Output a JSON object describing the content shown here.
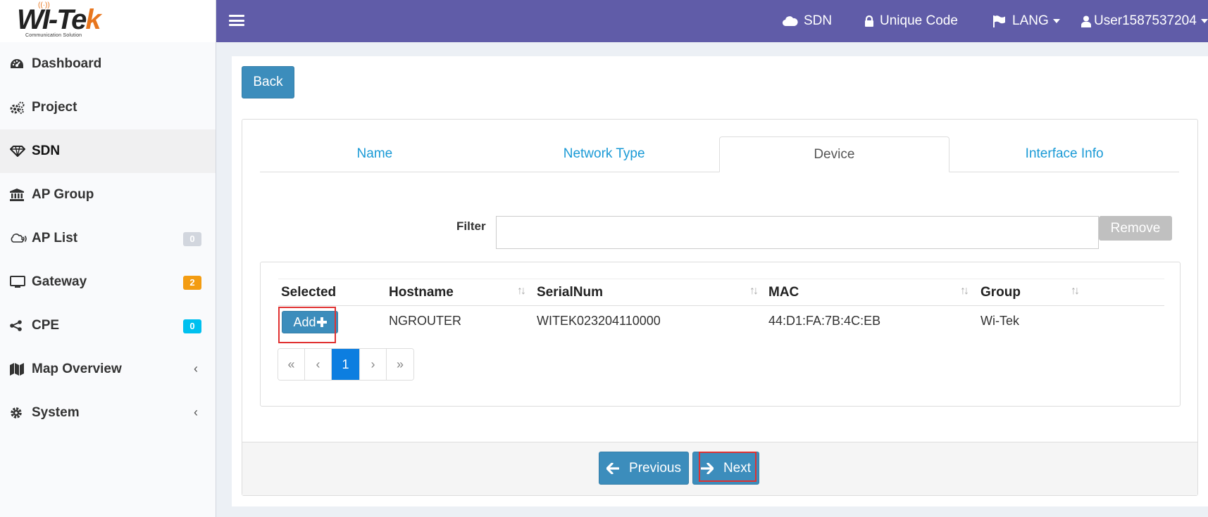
{
  "brand": {
    "logo_main": "WI-Te",
    "logo_k": "k",
    "logo_sub": "Communication Solution",
    "accent": "#e8761e"
  },
  "header": {
    "bg_color": "#605ca8",
    "sdn": "SDN",
    "unique_code": "Unique Code",
    "lang": "LANG",
    "user": "User1587537204"
  },
  "sidebar": {
    "items": [
      {
        "label": "Dashboard",
        "icon": "dashboard-icon"
      },
      {
        "label": "Project",
        "icon": "cogs-icon"
      },
      {
        "label": "SDN",
        "icon": "diamond-icon",
        "active": true
      },
      {
        "label": "AP Group",
        "icon": "bank-icon"
      },
      {
        "label": "AP List",
        "icon": "cloud-wifi-icon",
        "badge": "0",
        "badge_color": "#d2d6de"
      },
      {
        "label": "Gateway",
        "icon": "monitor-icon",
        "badge": "2",
        "badge_color": "#f39c12"
      },
      {
        "label": "CPE",
        "icon": "share-icon",
        "badge": "0",
        "badge_color": "#00c0ef"
      },
      {
        "label": "Map Overview",
        "icon": "map-icon",
        "chevron": "‹"
      },
      {
        "label": "System",
        "icon": "gear-icon",
        "chevron": "‹"
      }
    ]
  },
  "main": {
    "back_label": "Back",
    "tabs": [
      "Name",
      "Network Type",
      "Device",
      "Interface Info"
    ],
    "active_tab": "Device",
    "filter_label": "Filter",
    "filter_value": "",
    "remove_label": "Remove",
    "table": {
      "headers": [
        "Selected",
        "Hostname",
        "SerialNum",
        "MAC",
        "Group"
      ],
      "rows": [
        {
          "action": "Add",
          "hostname": "NGROUTER",
          "serial": "WITEK023204110000",
          "mac": "44:D1:FA:7B:4C:EB",
          "group": "Wi-Tek"
        }
      ]
    },
    "pagination": [
      "«",
      "‹",
      "1",
      "›",
      "»"
    ],
    "current_page": "1",
    "previous_label": "Previous",
    "next_label": "Next"
  }
}
